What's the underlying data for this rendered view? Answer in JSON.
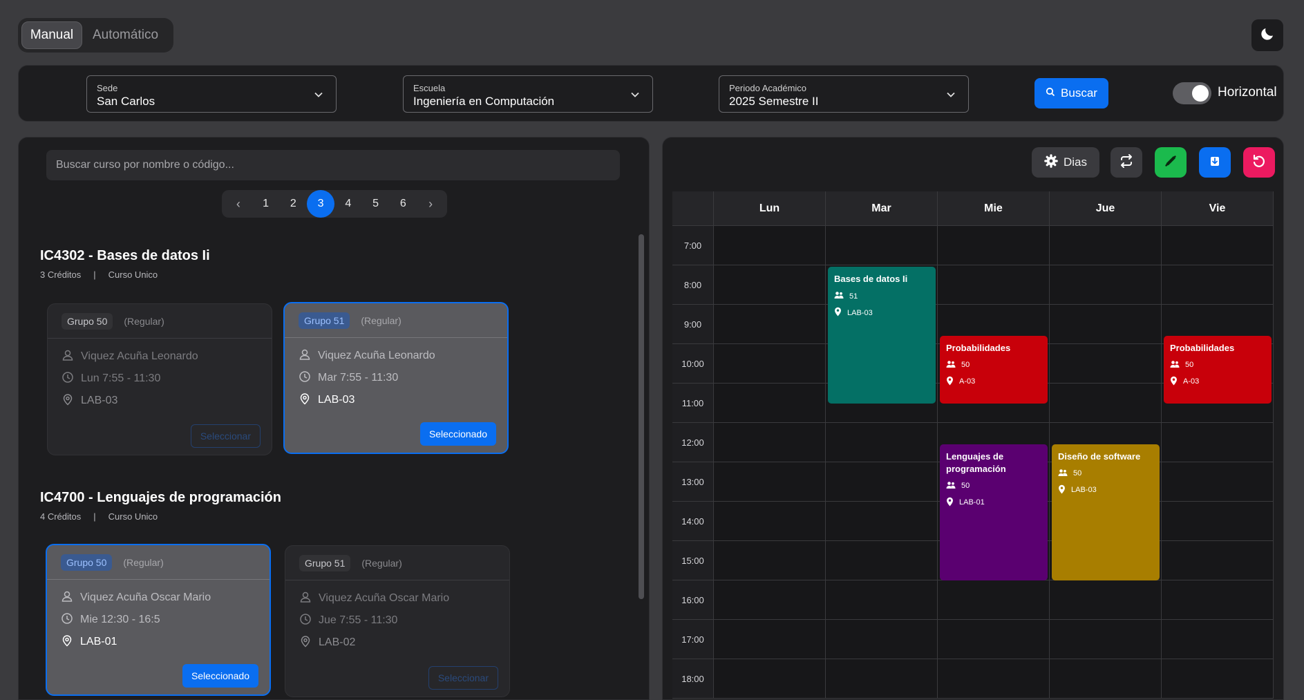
{
  "mode": {
    "manual": "Manual",
    "auto": "Automático"
  },
  "filters": {
    "sede": {
      "label": "Sede",
      "value": "San Carlos"
    },
    "escuela": {
      "label": "Escuela",
      "value": "Ingeniería en Computación"
    },
    "periodo": {
      "label": "Periodo Académico",
      "value": "2025 Semestre II"
    },
    "search_label": "Buscar",
    "orientation_label": "Horizontal"
  },
  "left": {
    "search_placeholder": "Buscar curso por nombre o código...",
    "pages": [
      "1",
      "2",
      "3",
      "4",
      "5",
      "6"
    ],
    "current_page": "3",
    "courses": [
      {
        "title": "IC4302 - Bases de datos Ii",
        "credits": "3 Créditos",
        "separator": "|",
        "kind": "Curso Unico",
        "groups": [
          {
            "name": "Grupo 50",
            "type": "(Regular)",
            "teacher": "Viquez Acuña Leonardo",
            "schedule": "Lun 7:55 - 11:30",
            "room": "LAB-03",
            "button": "Seleccionar",
            "selected": false
          },
          {
            "name": "Grupo 51",
            "type": "(Regular)",
            "teacher": "Viquez Acuña Leonardo",
            "schedule": "Mar 7:55 - 11:30",
            "room": "LAB-03",
            "button": "Seleccionado",
            "selected": true
          }
        ]
      },
      {
        "title": "IC4700 - Lenguajes de programación",
        "credits": "4 Créditos",
        "separator": "|",
        "kind": "Curso Unico",
        "groups": [
          {
            "name": "Grupo 50",
            "type": "(Regular)",
            "teacher": "Viquez Acuña Oscar Mario",
            "schedule": "Mie 12:30 - 16:5",
            "room": "LAB-01",
            "button": "Seleccionado",
            "selected": true
          },
          {
            "name": "Grupo 51",
            "type": "(Regular)",
            "teacher": "Viquez Acuña Oscar Mario",
            "schedule": "Jue 7:55 - 11:30",
            "room": "LAB-02",
            "button": "Seleccionar",
            "selected": false
          }
        ]
      }
    ]
  },
  "right": {
    "days_button": "Dias",
    "day_names": [
      "Lun",
      "Mar",
      "Mie",
      "Jue",
      "Vie"
    ],
    "hours": [
      "7:00",
      "8:00",
      "9:00",
      "10:00",
      "11:00",
      "12:00",
      "13:00",
      "14:00",
      "15:00",
      "16:00",
      "17:00",
      "18:00"
    ],
    "events": [
      {
        "title": "Bases de datos Ii",
        "count": "51",
        "room": "LAB-03",
        "day_index": 1,
        "start_hour": 8.0,
        "end_hour": 11.5,
        "color": "#047065"
      },
      {
        "title": "Probabilidades",
        "count": "50",
        "room": "A-03",
        "day_index": 2,
        "start_hour": 9.75,
        "end_hour": 11.5,
        "color": "#c8000a"
      },
      {
        "title": "Probabilidades",
        "count": "50",
        "room": "A-03",
        "day_index": 4,
        "start_hour": 9.75,
        "end_hour": 11.5,
        "color": "#c8000a"
      },
      {
        "title": "Lenguajes de programación",
        "count": "50",
        "room": "LAB-01",
        "day_index": 2,
        "start_hour": 12.5,
        "end_hour": 16.0,
        "color": "#5a0070"
      },
      {
        "title": "Diseño de software",
        "count": "50",
        "room": "LAB-03",
        "day_index": 3,
        "start_hour": 12.5,
        "end_hour": 16.0,
        "color": "#a87e00"
      }
    ]
  }
}
